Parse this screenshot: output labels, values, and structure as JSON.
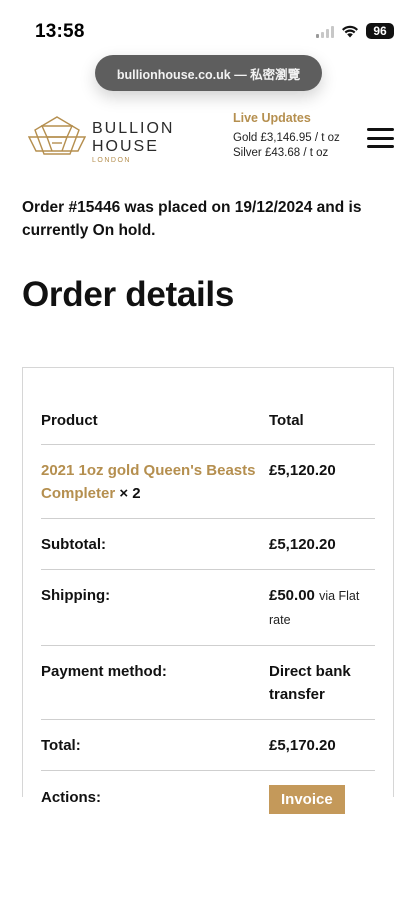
{
  "status": {
    "time": "13:58",
    "battery": "96"
  },
  "browser": {
    "url": "bullionhouse.co.uk — 私密瀏覽"
  },
  "header": {
    "logo_line1": "BULLION",
    "logo_line2": "HOUSE",
    "logo_sub": "LONDON",
    "live_title": "Live Updates",
    "gold": "Gold £3,146.95 / t oz",
    "silver": "Silver £43.68 / t oz"
  },
  "notice": "Order #15446 was placed on 19/12/2024 and is currently On hold.",
  "page_title": "Order details",
  "order": {
    "col_product": "Product",
    "col_total": "Total",
    "item_name": "2021 1oz gold Queen's Beasts Completer",
    "item_qty": "× 2",
    "item_total": "£5,120.20",
    "subtotal_label": "Subtotal:",
    "subtotal_value": "£5,120.20",
    "shipping_label": "Shipping:",
    "shipping_value": "£50.00",
    "shipping_note": "via Flat rate",
    "payment_label": "Payment method:",
    "payment_value": "Direct bank transfer",
    "total_label": "Total:",
    "total_value": "£5,170.20",
    "actions_label": "Actions:",
    "invoice_label": "Invoice"
  },
  "colors": {
    "accent": "#b58f4f",
    "button": "#c4995a"
  },
  "icons": [
    "signal-icon",
    "wifi-icon",
    "battery-icon",
    "logo-icon",
    "menu-icon"
  ]
}
